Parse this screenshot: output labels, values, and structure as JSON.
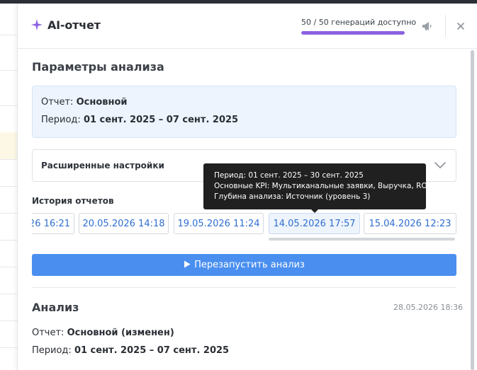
{
  "header": {
    "title": "AI-отчет",
    "quota_text": "50 / 50 генераций доступно",
    "quota_fraction": 1.0,
    "accent_color": "#8b62e0"
  },
  "params": {
    "title": "Параметры анализа",
    "report_label": "Отчет:",
    "report_value": "Основной",
    "period_label": "Период:",
    "period_value": "01 сент. 2025 – 07 сент. 2025"
  },
  "advanced": {
    "label": "Расширенные настройки"
  },
  "history": {
    "label": "История отчетов",
    "items": [
      {
        "label": "26 16:21",
        "active": false
      },
      {
        "label": "20.05.2026 14:18",
        "active": false
      },
      {
        "label": "19.05.2026 11:24",
        "active": false
      },
      {
        "label": "14.05.2026 17:57",
        "active": true
      },
      {
        "label": "15.04.2026 12:23",
        "active": false
      }
    ]
  },
  "tooltip": {
    "line1": "Период: 01 сент. 2025 – 30 сент. 2025",
    "line2": "Основные KPI: Мультиканальные заявки, Выручка, ROI",
    "line3": "Глубина анализа: Источник (уровень 3)"
  },
  "restart_button": {
    "label": "Перезапустить анализ",
    "color": "#4a8ff0"
  },
  "analysis": {
    "title": "Анализ",
    "timestamp": "28.05.2026 18:36",
    "report_label": "Отчет:",
    "report_value": "Основной (изменен)",
    "period_label": "Период:",
    "period_value": "01 сент. 2025 – 07 сент. 2025"
  },
  "icons": {
    "title": "sparkle-icon",
    "announce": "megaphone-icon",
    "close": "close-icon",
    "chevron": "chevron-down-icon",
    "play": "play-icon"
  }
}
